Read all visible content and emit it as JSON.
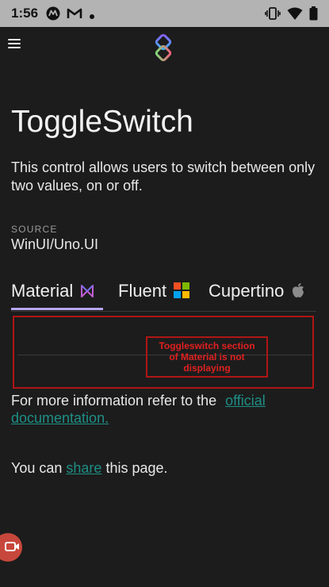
{
  "status_bar": {
    "time": "1:56",
    "left_icons": [
      "motorola-icon",
      "gmail-icon",
      "dot-icon"
    ],
    "right_icons": [
      "vibrate-icon",
      "wifi-icon",
      "battery-icon"
    ]
  },
  "app_bar": {
    "menu_icon": "hamburger-icon",
    "logo_icon": "uno-logo-icon"
  },
  "page": {
    "title": "ToggleSwitch",
    "description": "This control allows users to switch between only two values, on or off.",
    "source_label": "SOURCE",
    "source_value": "WinUI/Uno.UI"
  },
  "tabs": [
    {
      "label": "Material",
      "icon": "material-icon",
      "selected": true
    },
    {
      "label": "Fluent",
      "icon": "windows-icon",
      "selected": false
    },
    {
      "label": "Cupertino",
      "icon": "apple-icon",
      "selected": false
    }
  ],
  "annotation": {
    "line1": "Toggleswitch section",
    "line2": "of Material is not",
    "line3": "displaying"
  },
  "info": {
    "prefix": "For more information refer to the ",
    "link_part1": "official",
    "link_part2": "documentation.",
    "share_prefix": "You can ",
    "share_link": "share",
    "share_suffix": " this page."
  },
  "colors": {
    "background": "#1c1c1c",
    "status_bar": "#b3b3b3",
    "accent_tab": "#b7a6f0",
    "link": "#1e8f86",
    "annotation_red": "#b01515",
    "record_button": "#c8473c"
  }
}
